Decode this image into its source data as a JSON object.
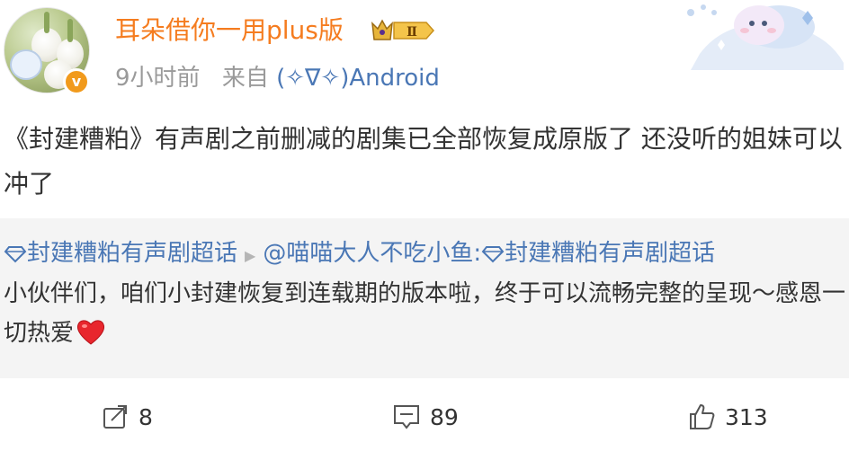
{
  "header": {
    "username": "耳朵借你一用plus版",
    "badge_level": "Ⅱ",
    "time": "9小时前",
    "source_prefix": "来自",
    "source_device": "(✧∇✧)Android",
    "verify_mark": "v"
  },
  "post": {
    "text": "《封建糟粕》有声剧之前删减的剧集已全部恢复成原版了 还没听的姐妹可以冲了"
  },
  "repost": {
    "topic": "封建糟粕有声剧超话",
    "separator_icon": "triangle-right-icon",
    "author": "@喵喵大人不吃小鱼:",
    "topic2": "封建糟粕有声剧超话",
    "body": "小伙伴们，咱们小封建恢复到连载期的版本啦，终于可以流畅完整的呈现～感恩一切热爱"
  },
  "actions": {
    "repost_count": "8",
    "comment_count": "89",
    "like_count": "313"
  },
  "colors": {
    "username": "#f57c1f",
    "link": "#4a77b5",
    "meta": "#9a9a9a",
    "repost_bg": "#f4f4f4",
    "verify": "#f19a1c"
  }
}
